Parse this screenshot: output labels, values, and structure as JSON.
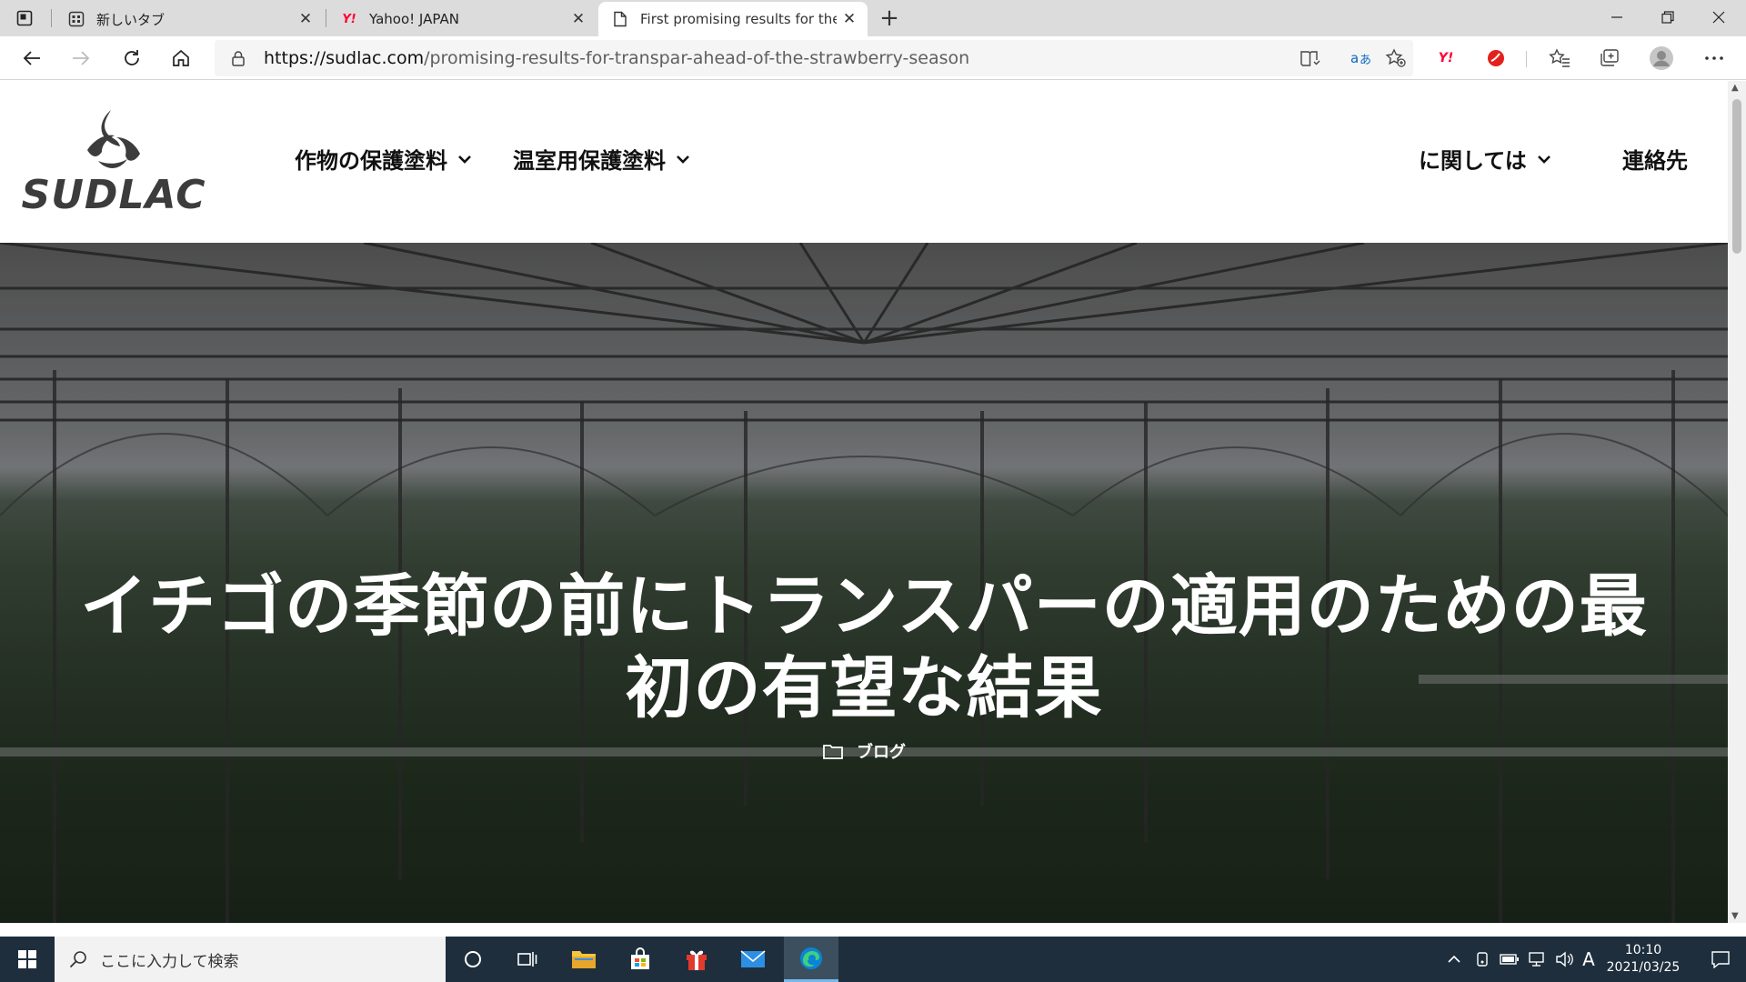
{
  "browser": {
    "tabs": [
      {
        "title": "新しいタブ",
        "icon": "new-tab-page-icon",
        "active": false
      },
      {
        "title": "Yahoo! JAPAN",
        "icon": "yahoo-icon",
        "active": false
      },
      {
        "title": "First promising results for the ap",
        "icon": "page-icon",
        "active": true
      }
    ],
    "tab_close_glyph": "✕",
    "new_tab_glyph": "+",
    "url_domain": "https://sudlac.com",
    "url_path": "/promising-results-for-transpar-ahead-of-the-strawberry-season",
    "yahoo_glyph": "Y!"
  },
  "site": {
    "logo_text": "SUDLAC",
    "nav": {
      "crop_coatings": "作物の保護塗料",
      "greenhouse_coatings": "温室用保護塗料",
      "about": "に関しては",
      "contact": "連絡先"
    },
    "hero": {
      "title_line1": "イチゴの季節の前にトランスパーの適用のための最",
      "title_line2": "初の有望な結果",
      "category": "ブログ"
    }
  },
  "taskbar": {
    "search_placeholder": "ここに入力して検索",
    "ime_indicator": "A",
    "time": "10:10",
    "date": "2021/03/25"
  },
  "colors": {
    "taskbar_bg": "#1e2e3c",
    "tab_strip_bg": "#dcdcdc",
    "edge_accent": "#0a84d6",
    "yahoo_red": "#ff0033"
  }
}
